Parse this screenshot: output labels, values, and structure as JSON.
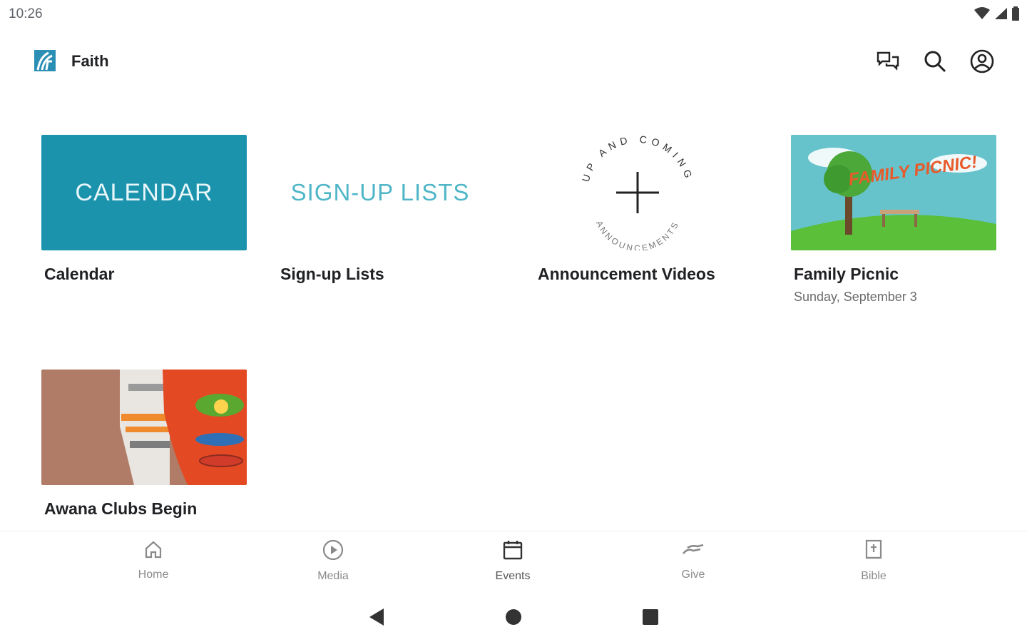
{
  "status_bar": {
    "time": "10:26"
  },
  "app_bar": {
    "title": "Faith",
    "icons": [
      "chat-icon",
      "search-icon",
      "account-icon"
    ]
  },
  "cards": [
    {
      "title": "Calendar",
      "subtitle": "",
      "thumb_text": "CALENDAR"
    },
    {
      "title": "Sign-up Lists",
      "subtitle": "",
      "thumb_text": "SIGN-UP LISTS"
    },
    {
      "title": "Announcement Videos",
      "subtitle": "",
      "thumb_text_top": "UP AND COMING",
      "thumb_text_bottom": "ANNOUNCEMENTS"
    },
    {
      "title": "Family Picnic",
      "subtitle": "Sunday, September 3",
      "thumb_text": "FAMILY PICNIC!"
    },
    {
      "title": "Awana Clubs Begin",
      "subtitle": ""
    }
  ],
  "bottom_nav": [
    {
      "label": "Home",
      "icon": "home-icon"
    },
    {
      "label": "Media",
      "icon": "play-circle-icon"
    },
    {
      "label": "Events",
      "icon": "calendar-icon",
      "active": true
    },
    {
      "label": "Give",
      "icon": "give-hand-icon"
    },
    {
      "label": "Bible",
      "icon": "bible-icon"
    }
  ],
  "colors": {
    "accent": "#1b93ad",
    "signup_text": "#4fb6c7",
    "nav_inactive": "#8a8a8a"
  }
}
